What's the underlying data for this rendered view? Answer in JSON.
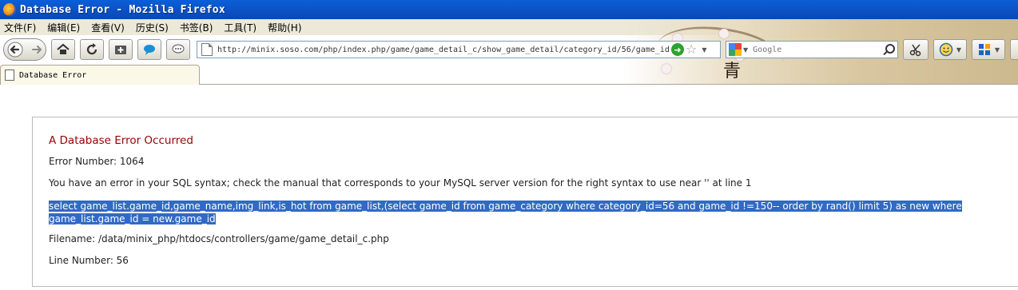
{
  "window": {
    "title": "Database Error - Mozilla Firefox"
  },
  "menu": {
    "items": [
      "文件(F)",
      "编辑(E)",
      "查看(V)",
      "历史(S)",
      "书签(B)",
      "工具(T)",
      "帮助(H)"
    ]
  },
  "navbar": {
    "url": "http://minix.soso.com/php/index.php/game/game_detail_c/show_game_detail/category_id/56/game_id",
    "search_placeholder": "Google"
  },
  "tabs": [
    {
      "label": "Database Error"
    }
  ],
  "error": {
    "heading": "A Database Error Occurred",
    "number_line": "Error Number: 1064",
    "message": "You have an error in your SQL syntax; check the manual that corresponds to your MySQL server version for the right syntax to use near '' at line 1",
    "sql_line1": "select game_list.game_id,game_name,img_link,is_hot from game_list,(select game_id from game_category where category_id=56 and game_id !=150-- order by rand() limit 5) as new where",
    "sql_line2": "game_list.game_id = new.game_id",
    "filename_line": "Filename: /data/minix_php/htdocs/controllers/game/game_detail_c.php",
    "line_number_line": "Line Number: 56"
  },
  "colors": {
    "titlebar": "#0a5fd8",
    "heading": "#990000",
    "selection": "#316ac5"
  }
}
